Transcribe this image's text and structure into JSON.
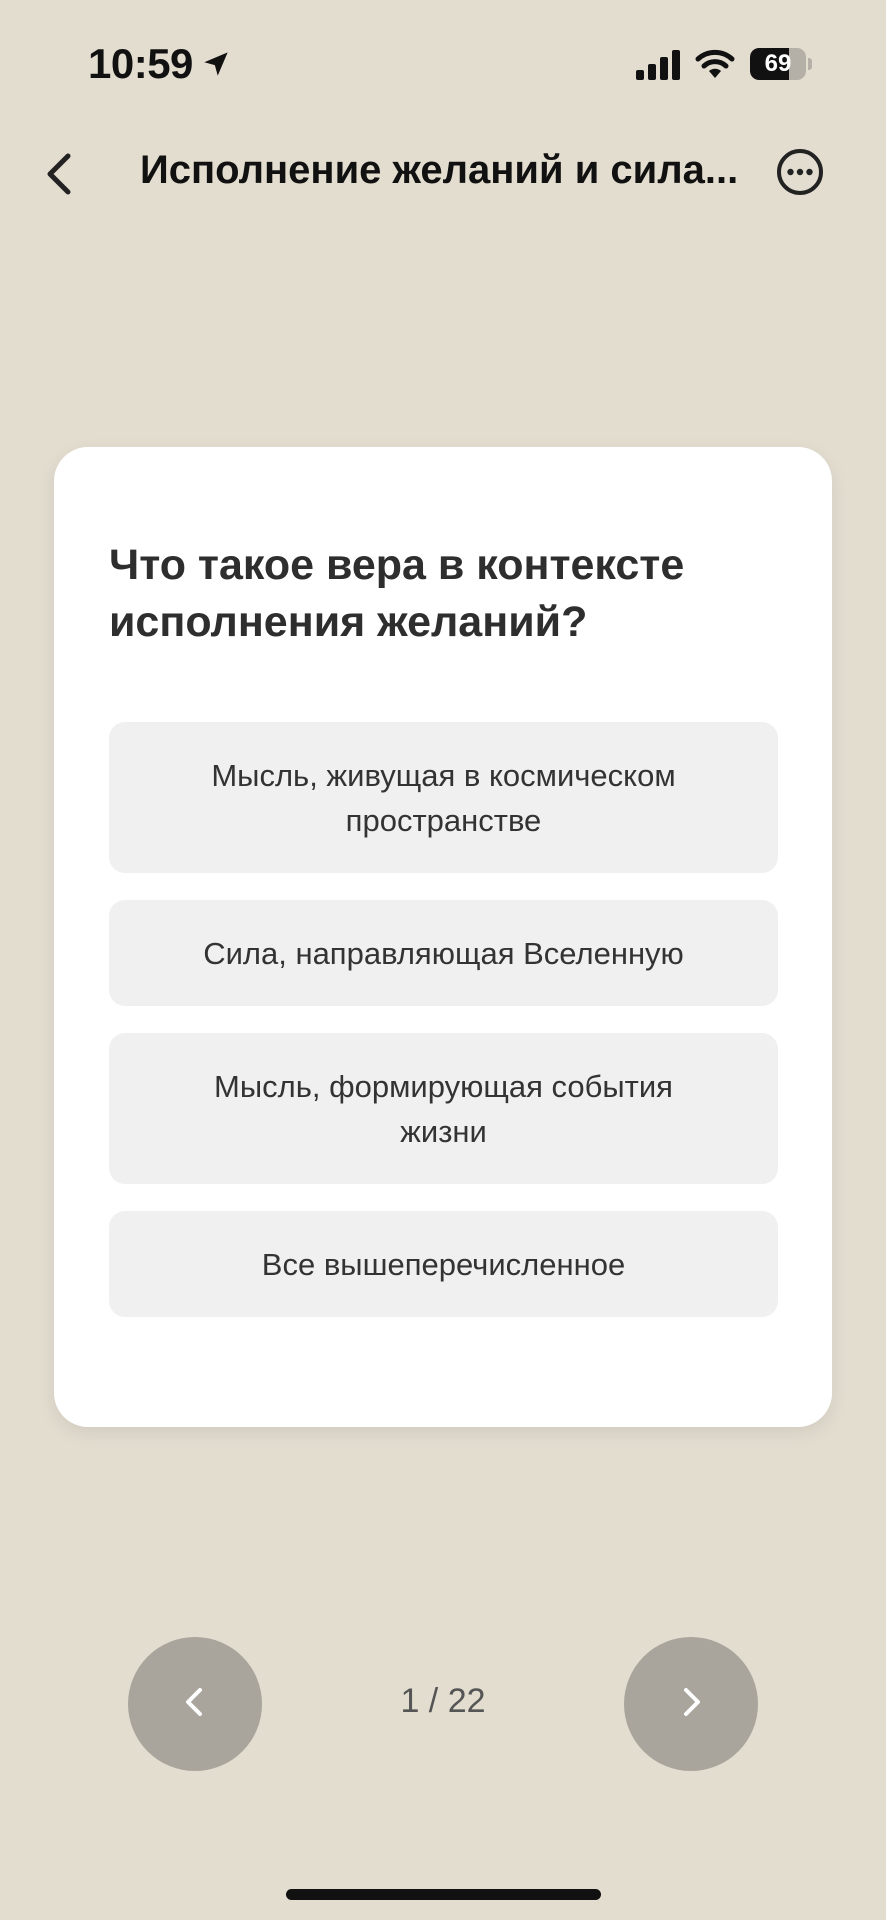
{
  "status_bar": {
    "time": "10:59",
    "battery_level": 69,
    "battery_text": "69",
    "icons": [
      "location-arrow-icon",
      "cellular-signal-icon",
      "wifi-icon",
      "battery-icon"
    ]
  },
  "header": {
    "title": "Исполнение желаний и сила...",
    "back_icon": "chevron-left-icon",
    "more_icon": "more-circle-icon"
  },
  "quiz": {
    "question": "Что такое вера в контексте исполнения желаний?",
    "answers": [
      {
        "text": "Мысль, живущая в космическом пространстве"
      },
      {
        "text": "Сила, направляющая Вселенную"
      },
      {
        "text": "Мысль, формирующая события жизни"
      },
      {
        "text": "Все вышеперечисленное"
      }
    ]
  },
  "navigation": {
    "counter": "1 / 22",
    "prev_icon": "chevron-left-icon",
    "next_icon": "chevron-right-icon"
  },
  "colors": {
    "background": "#e3ddd0",
    "card": "#ffffff",
    "answer_bg": "#f0f0f0",
    "nav_button": "#a9a59d"
  }
}
